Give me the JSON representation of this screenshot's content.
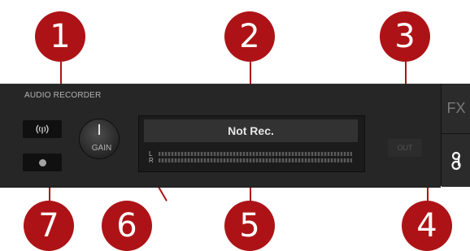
{
  "panel": {
    "title": "AUDIO RECORDER",
    "gain_label": "GAIN",
    "status_text": "Not Rec.",
    "meter_left": "L",
    "meter_right": "R",
    "out_label": "OUT",
    "fx_label": "FX"
  },
  "callouts": {
    "c1": "1",
    "c2": "2",
    "c3": "3",
    "c4": "4",
    "c5": "5",
    "c6": "6",
    "c7": "7"
  },
  "icons": {
    "broadcast": "broadcast-icon",
    "record": "record-dot-icon",
    "cassette": "cassette-tab-icon"
  },
  "colors": {
    "callout": "#ad1316",
    "panel": "#262626",
    "cassette_accent": "#f5f5f5"
  }
}
